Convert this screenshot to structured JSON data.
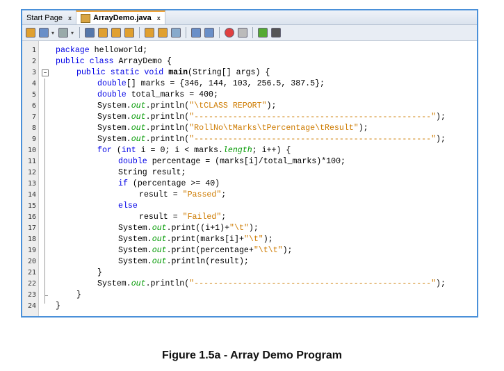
{
  "tabs": [
    {
      "label": "Start Page",
      "close": "x"
    },
    {
      "label": "ArrayDemo.java",
      "close": "x"
    }
  ],
  "toolbar": {
    "icons": [
      "back-history-icon",
      "source-icon",
      "history-icon",
      "find-icon",
      "find-previous-icon",
      "find-next-icon",
      "toggle-highlight-icon",
      "previous-bookmark-icon",
      "next-bookmark-icon",
      "toggle-bookmark-icon",
      "shift-left-icon",
      "shift-right-icon",
      "start-macro-icon",
      "stop-macro-icon",
      "comment-icon",
      "uncomment-icon"
    ]
  },
  "colors": {
    "keyword": "#0000e6",
    "string": "#ce7b00",
    "field": "#009900",
    "border": "#4a90d9"
  },
  "code": [
    {
      "n": "1",
      "indent": 0,
      "tokens": [
        [
          "package",
          "kw"
        ],
        [
          " helloworld;",
          ""
        ]
      ]
    },
    {
      "n": "2",
      "indent": 0,
      "tokens": [
        [
          "public class",
          "kw"
        ],
        [
          " ArrayDemo {",
          ""
        ]
      ]
    },
    {
      "n": "3",
      "indent": 1,
      "tokens": [
        [
          "public static void",
          "kw"
        ],
        [
          " ",
          ""
        ],
        [
          "main",
          "fn"
        ],
        [
          "(String[] args) {",
          ""
        ]
      ]
    },
    {
      "n": "4",
      "indent": 2,
      "tokens": [
        [
          "double",
          "kw"
        ],
        [
          "[] marks = {346, 144, 103, 256.5, 387.5};",
          ""
        ]
      ]
    },
    {
      "n": "5",
      "indent": 2,
      "tokens": [
        [
          "double",
          "kw"
        ],
        [
          " total_marks = 400;",
          ""
        ]
      ]
    },
    {
      "n": "6",
      "indent": 2,
      "tokens": [
        [
          "System.",
          ""
        ],
        [
          "out",
          "fld"
        ],
        [
          ".println(",
          ""
        ],
        [
          "\"\\tCLASS REPORT\"",
          "str"
        ],
        [
          ");",
          ""
        ]
      ]
    },
    {
      "n": "7",
      "indent": 2,
      "tokens": [
        [
          "System.",
          ""
        ],
        [
          "out",
          "fld"
        ],
        [
          ".println(",
          ""
        ],
        [
          "\"-------------------------------------------------\"",
          "str"
        ],
        [
          ");",
          ""
        ]
      ]
    },
    {
      "n": "8",
      "indent": 2,
      "tokens": [
        [
          "System.",
          ""
        ],
        [
          "out",
          "fld"
        ],
        [
          ".println(",
          ""
        ],
        [
          "\"RollNo\\tMarks\\tPercentage\\tResult\"",
          "str"
        ],
        [
          ");",
          ""
        ]
      ]
    },
    {
      "n": "9",
      "indent": 2,
      "tokens": [
        [
          "System.",
          ""
        ],
        [
          "out",
          "fld"
        ],
        [
          ".println(",
          ""
        ],
        [
          "\"-------------------------------------------------\"",
          "str"
        ],
        [
          ");",
          ""
        ]
      ]
    },
    {
      "n": "10",
      "indent": 2,
      "tokens": [
        [
          "for",
          "kw"
        ],
        [
          " (",
          ""
        ],
        [
          "int",
          "kw"
        ],
        [
          " i = 0; i < marks.",
          ""
        ],
        [
          "length",
          "fld"
        ],
        [
          "; i++) {",
          ""
        ]
      ]
    },
    {
      "n": "11",
      "indent": 3,
      "tokens": [
        [
          "double",
          "kw"
        ],
        [
          " percentage = (marks[i]/total_marks)*100;",
          ""
        ]
      ]
    },
    {
      "n": "12",
      "indent": 3,
      "tokens": [
        [
          "String result;",
          ""
        ]
      ]
    },
    {
      "n": "13",
      "indent": 3,
      "tokens": [
        [
          "if",
          "kw"
        ],
        [
          " (percentage >= 40)",
          ""
        ]
      ]
    },
    {
      "n": "14",
      "indent": 4,
      "tokens": [
        [
          "result = ",
          ""
        ],
        [
          "\"Passed\"",
          "str"
        ],
        [
          ";",
          ""
        ]
      ]
    },
    {
      "n": "15",
      "indent": 3,
      "tokens": [
        [
          "else",
          "kw"
        ]
      ]
    },
    {
      "n": "16",
      "indent": 4,
      "tokens": [
        [
          "result = ",
          ""
        ],
        [
          "\"Failed\"",
          "str"
        ],
        [
          ";",
          ""
        ]
      ]
    },
    {
      "n": "17",
      "indent": 3,
      "tokens": [
        [
          "System.",
          ""
        ],
        [
          "out",
          "fld"
        ],
        [
          ".print((i+1)+",
          ""
        ],
        [
          "\"\\t\"",
          "str"
        ],
        [
          ");",
          ""
        ]
      ]
    },
    {
      "n": "18",
      "indent": 3,
      "tokens": [
        [
          "System.",
          ""
        ],
        [
          "out",
          "fld"
        ],
        [
          ".print(marks[i]+",
          ""
        ],
        [
          "\"\\t\"",
          "str"
        ],
        [
          ");",
          ""
        ]
      ]
    },
    {
      "n": "19",
      "indent": 3,
      "tokens": [
        [
          "System.",
          ""
        ],
        [
          "out",
          "fld"
        ],
        [
          ".print(percentage+",
          ""
        ],
        [
          "\"\\t\\t\"",
          "str"
        ],
        [
          ");",
          ""
        ]
      ]
    },
    {
      "n": "20",
      "indent": 3,
      "tokens": [
        [
          "System.",
          ""
        ],
        [
          "out",
          "fld"
        ],
        [
          ".println(result);",
          ""
        ]
      ]
    },
    {
      "n": "21",
      "indent": 2,
      "tokens": [
        [
          "}",
          ""
        ]
      ]
    },
    {
      "n": "22",
      "indent": 2,
      "tokens": [
        [
          "System.",
          ""
        ],
        [
          "out",
          "fld"
        ],
        [
          ".println(",
          ""
        ],
        [
          "\"-------------------------------------------------\"",
          "str"
        ],
        [
          ");",
          ""
        ]
      ]
    },
    {
      "n": "23",
      "indent": 1,
      "tokens": [
        [
          "}",
          ""
        ]
      ]
    },
    {
      "n": "24",
      "indent": 0,
      "tokens": [
        [
          "}",
          ""
        ]
      ]
    }
  ],
  "caption": "Figure 1.5a - Array Demo Program"
}
